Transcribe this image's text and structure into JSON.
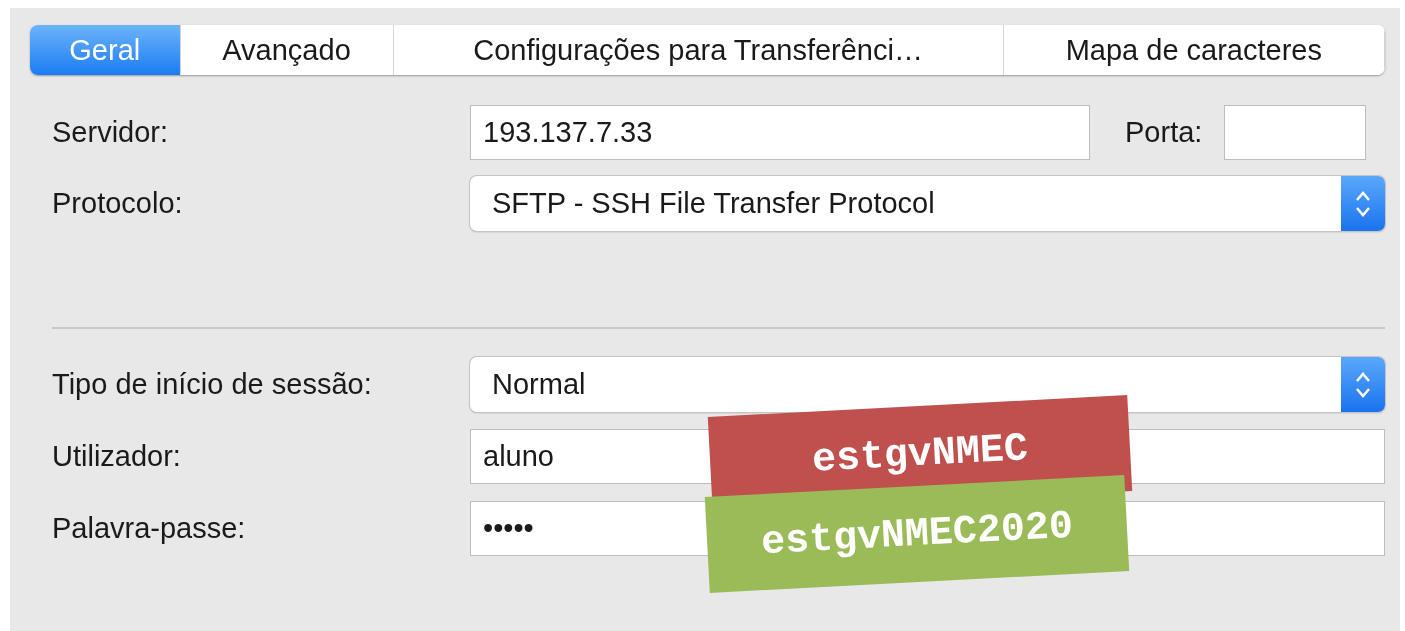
{
  "tabs": [
    {
      "label": "Geral",
      "selected": true
    },
    {
      "label": "Avançado",
      "selected": false
    },
    {
      "label": "Configurações para Transferênci…",
      "selected": false
    },
    {
      "label": "Mapa de caracteres",
      "selected": false
    }
  ],
  "server": {
    "label": "Servidor:",
    "value": "193.137.7.33",
    "port_label": "Porta:"
  },
  "protocol": {
    "label": "Protocolo:",
    "value": "SFTP - SSH File Transfer Protocol"
  },
  "logon_type": {
    "label": "Tipo de início de sessão:",
    "value": "Normal"
  },
  "user": {
    "label": "Utilizador:",
    "value": "aluno"
  },
  "password": {
    "label": "Palavra-passe:",
    "value": "•••••"
  },
  "annotations": [
    {
      "text": "estgvNMEC",
      "color": "#c0504d"
    },
    {
      "text": "estgvNMEC2020",
      "color": "#9bbb59"
    }
  ]
}
